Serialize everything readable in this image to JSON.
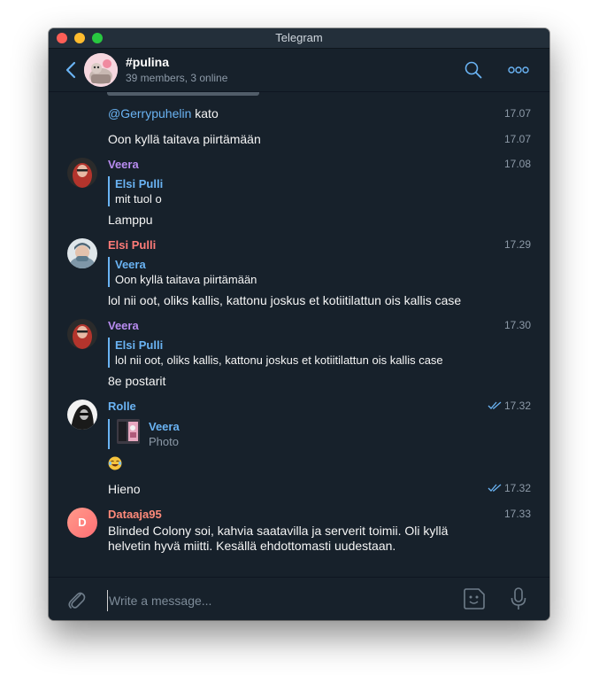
{
  "window": {
    "title": "Telegram"
  },
  "chat": {
    "title": "#pulina",
    "status": "39 members, 3 online"
  },
  "messages": [
    {
      "text_mention": "@Gerrypuhelin",
      "text": " kato",
      "time": "17.07"
    },
    {
      "text": "Oon kyllä taitava piirtämään",
      "time": "17.07"
    },
    {
      "sender": "Veera",
      "time": "17.08",
      "reply_name": "Elsi Pulli",
      "reply_text": "mit tuol o",
      "text": "Lamppu"
    },
    {
      "sender": "Elsi Pulli",
      "time": "17.29",
      "reply_name": "Veera",
      "reply_text": "Oon kyllä taitava piirtämään",
      "text": "lol nii oot, oliks kallis, kattonu joskus et kotiitilattun ois kallis case"
    },
    {
      "sender": "Veera",
      "time": "17.30",
      "reply_name": "Elsi Pulli",
      "reply_text": "lol nii oot, oliks kallis, kattonu joskus et kotiitilattun ois kallis case",
      "text": "8e postarit"
    },
    {
      "sender": "Rolle",
      "time": "17.32",
      "reply_name": "Veera",
      "reply_text": "Photo",
      "emoji": "laughing-emoji"
    },
    {
      "text": "Hieno",
      "time": "17.32"
    },
    {
      "sender": "Dataaja95",
      "avatar_letter": "D",
      "time": "17.33",
      "text_line1": "Blinded Colony soi, kahvia saatavilla ja serverit toimii. Oli kyllä",
      "text_line2": "helvetin hyvä miitti. Kesällä ehdottomasti uudestaan."
    }
  ],
  "composer": {
    "placeholder": "Write a message..."
  },
  "colors": {
    "background": "#17212b",
    "accent": "#6ab3f3",
    "veera": "#b88cf0",
    "elsi": "#ff7b78",
    "rolle": "#6ab3f3",
    "dataaja": "#ff8a7a"
  },
  "icons": [
    "back-arrow-icon",
    "search-icon",
    "more-icon",
    "attach-icon",
    "sticker-icon",
    "microphone-icon",
    "double-check-icon"
  ]
}
